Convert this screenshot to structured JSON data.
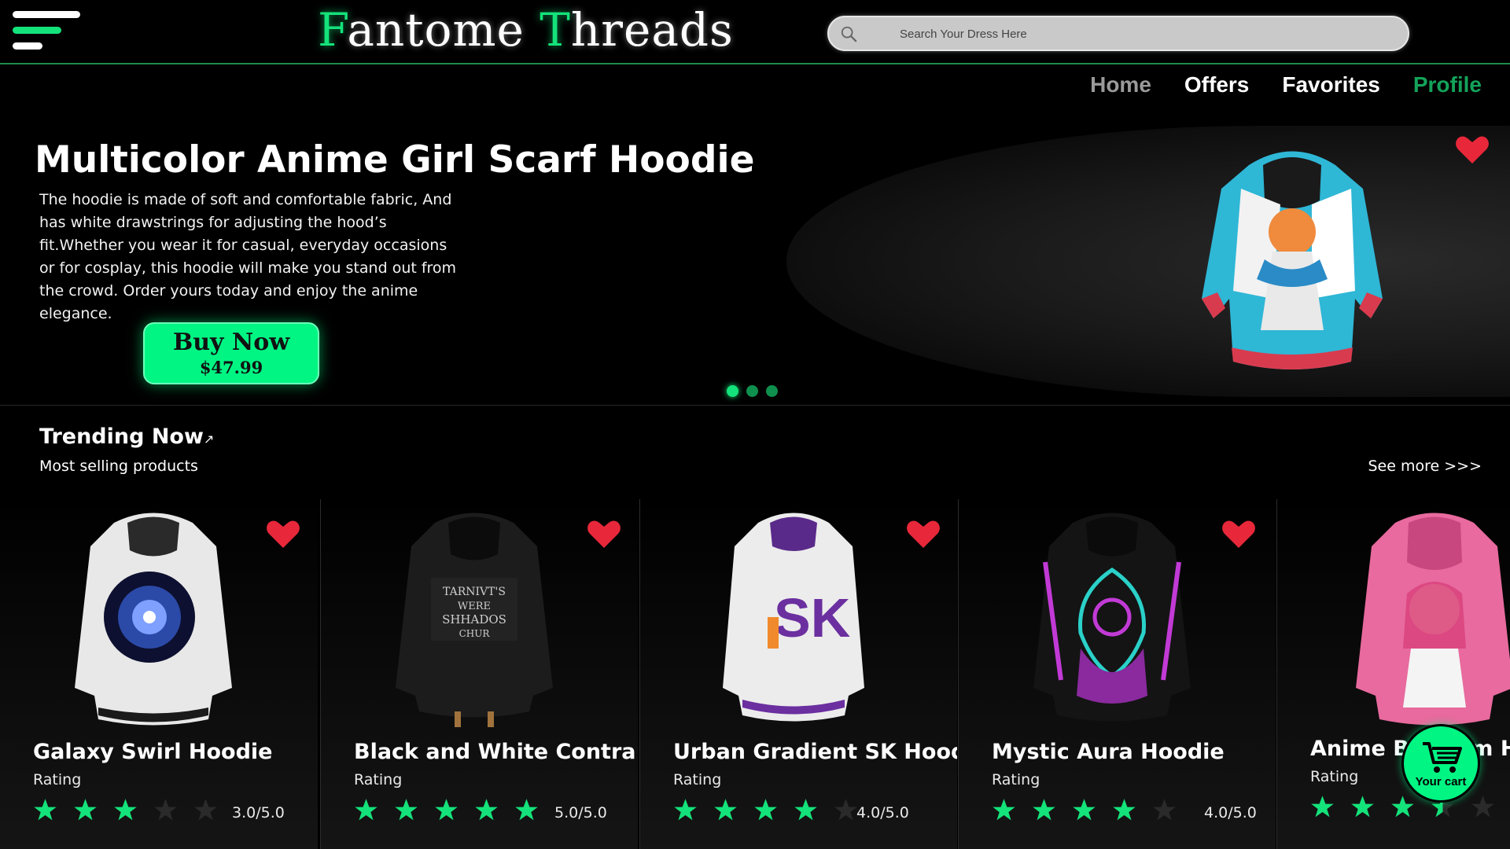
{
  "header": {
    "logo_first_cap": "F",
    "logo_first_rest": "antome ",
    "logo_second_cap": "T",
    "logo_second_rest": "hreads",
    "search_placeholder": "Search Your Dress Here",
    "menu_icon": "hamburger-menu-icon",
    "search_icon": "search-icon"
  },
  "nav": {
    "home": "Home",
    "offers": "Offers",
    "favorites": "Favorites",
    "profile": "Profile"
  },
  "hero": {
    "title": "Multicolor Anime Girl Scarf Hoodie",
    "description": "The hoodie is made of soft and comfortable fabric, And has white drawstrings for adjusting the hood’s fit.Whether you wear it for casual, everyday occasions or for cosplay, this hoodie will make you stand out from the crowd. Order yours today and enjoy the anime elegance.",
    "buy_label": "Buy Now",
    "price": "$47.99",
    "slide_count": 3,
    "active_slide": 1
  },
  "trending": {
    "title": "Trending Now",
    "title_icon": "↗",
    "subtitle": "Most selling products",
    "see_more": "See more >>>"
  },
  "products": [
    {
      "name": "Galaxy Swirl Hoodie",
      "rating_label": "Rating",
      "rating": 3,
      "score": "3.0/5.0"
    },
    {
      "name": "Black and White Contra..",
      "rating_label": "Rating",
      "rating": 5,
      "score": "5.0/5.0"
    },
    {
      "name": "Urban Gradient SK Hoodie",
      "rating_label": "Rating",
      "rating": 4,
      "score": "4.0/5.0"
    },
    {
      "name": "Mystic Aura Hoodie",
      "rating_label": "Rating",
      "rating": 4,
      "score": "4.0/5.0"
    },
    {
      "name": "Anime Blossom Hoodie",
      "rating_label": "Rating",
      "rating": 3.5,
      "score": ""
    }
  ],
  "cart": {
    "label": "Your cart"
  },
  "colors": {
    "accent": "#14e27a",
    "button": "#00f583",
    "heart": "#e8283a",
    "star_filled": "#14e27a",
    "star_empty": "#2a2a2a"
  }
}
